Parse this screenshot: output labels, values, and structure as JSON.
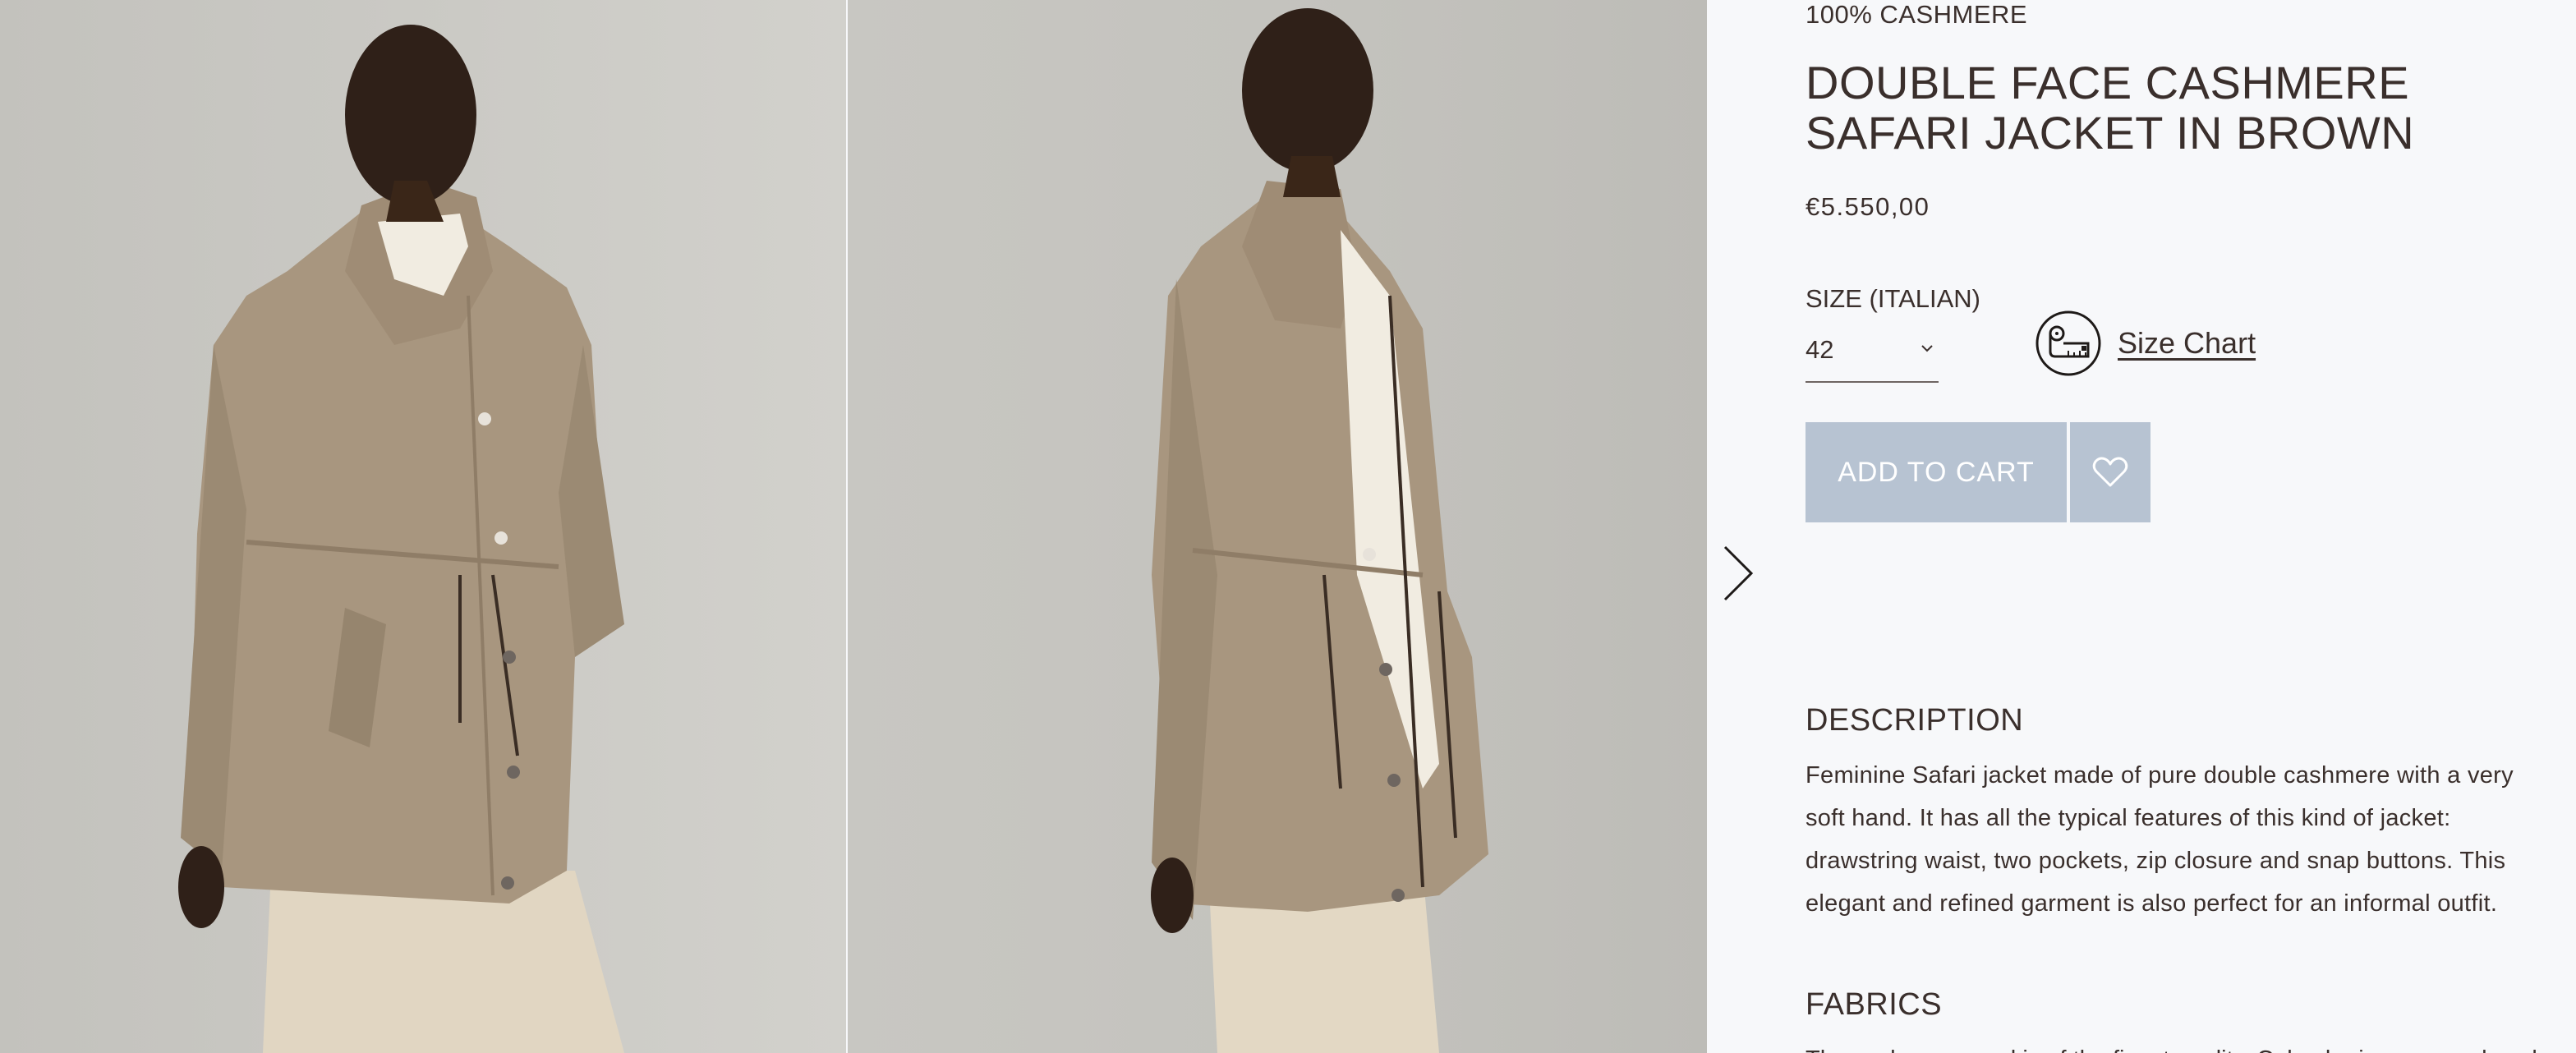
{
  "product": {
    "material": "100% CASHMERE",
    "title": "DOUBLE FACE CASHMERE SAFARI JACKET IN BROWN",
    "price": "€5.550,00",
    "size_label": "SIZE (ITALIAN)",
    "size_value": "42",
    "size_chart_label": "Size Chart",
    "add_to_cart_label": "ADD TO CART"
  },
  "description": {
    "heading": "DESCRIPTION",
    "text": "Feminine Safari jacket made of pure double cashmere with a very soft hand. It has all the typical features of this kind of jacket: drawstring waist, two pockets, zip closure and snap buttons. This elegant and refined garment is also perfect for an informal outfit."
  },
  "fabrics": {
    "heading": "FABRICS",
    "text": "The cashmere used is of the finest quality. Colombo is renowned worldwide"
  },
  "icons": {
    "next": "chevron-right-icon",
    "size_chart": "measuring-tape-icon",
    "wishlist": "heart-icon",
    "select": "chevron-down-icon"
  },
  "colors": {
    "button": "#b7c3d2",
    "text": "#3a2f2c",
    "panel_bg": "#f7f8fa"
  }
}
